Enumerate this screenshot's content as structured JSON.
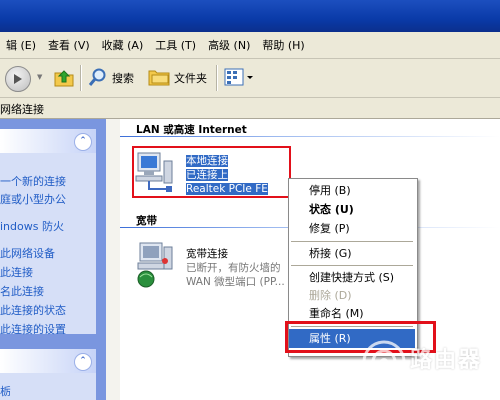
{
  "menubar": {
    "items": [
      "辑 (E)",
      "查看 (V)",
      "收藏 (A)",
      "工具 (T)",
      "高级 (N)",
      "帮助 (H)"
    ]
  },
  "toolbar": {
    "search_label": "搜索",
    "folders_label": "文件夹"
  },
  "address": {
    "text": "网络连接"
  },
  "left_panel": {
    "tasks": [
      "一个新的连接",
      "庭或小型办公",
      "indows 防火",
      "此网络设备",
      "此连接",
      "名此连接",
      "此连接的状态",
      "此连接的设置"
    ],
    "bottom_task": "栃"
  },
  "main": {
    "group_lan": "LAN 或高速 Internet",
    "lan_conn": {
      "name": "本地连接",
      "status": "已连接上",
      "device": "Realtek PCIe FE"
    },
    "group_broadband": "宽带",
    "bb_conn": {
      "name": "宽带连接",
      "status": "已断开，有防火墙的",
      "device": "WAN 微型端口 (PP..."
    }
  },
  "context_menu": {
    "items": [
      {
        "label": "停用 (B)",
        "style": "normal"
      },
      {
        "label": "状态 (U)",
        "style": "bold"
      },
      {
        "label": "修复 (P)",
        "style": "normal"
      },
      {
        "label": "桥接 (G)",
        "style": "normal"
      },
      {
        "label": "创建快捷方式 (S)",
        "style": "normal"
      },
      {
        "label": "删除 (D)",
        "style": "disabled"
      },
      {
        "label": "重命名 (M)",
        "style": "normal"
      },
      {
        "label": "属性 (R)",
        "style": "highlighted"
      }
    ]
  },
  "watermark": {
    "text": "路由器",
    "url": "luyouqi.com"
  },
  "colors": {
    "selection": "#316ac5",
    "highlight_box": "#e2101a",
    "panel_bg": "#d6dff7",
    "link": "#215dc6"
  },
  "icons": {
    "back": "back-arrow-icon",
    "up": "up-folder-icon",
    "search": "search-icon",
    "folders": "folders-icon",
    "views": "views-icon",
    "lan": "lan-connection-icon",
    "broadband": "broadband-connection-icon"
  }
}
